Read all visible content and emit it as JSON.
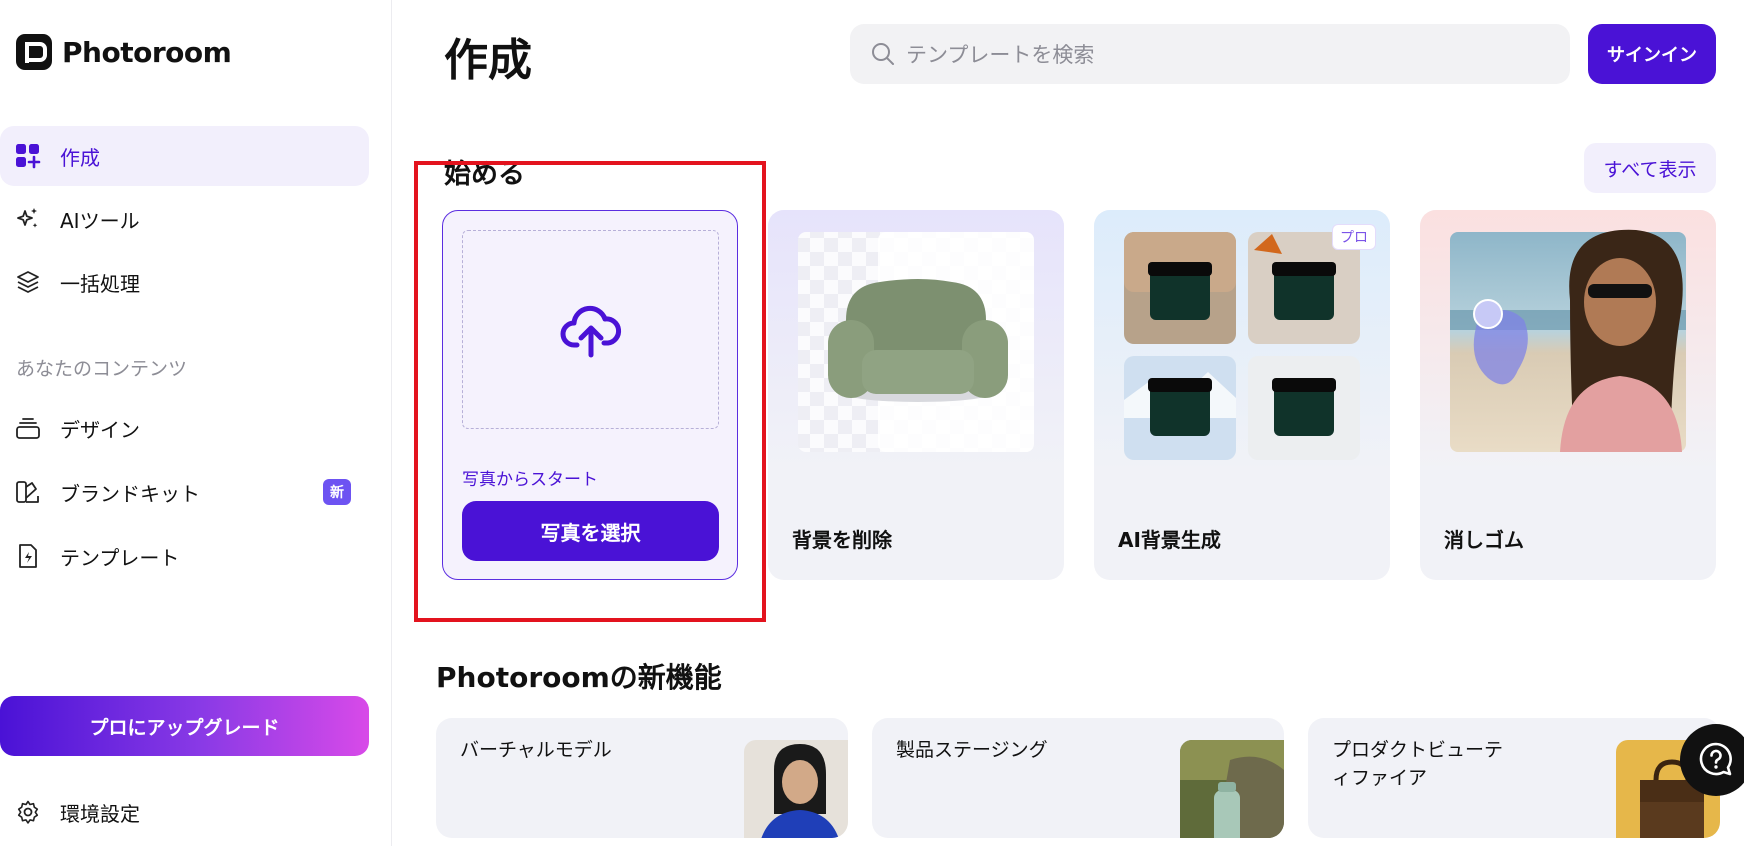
{
  "brand": {
    "name": "Photoroom"
  },
  "nav": {
    "items": [
      {
        "label": "作成",
        "icon": "grid-plus-icon",
        "active": true
      },
      {
        "label": "AIツール",
        "icon": "sparkle-icon",
        "active": false
      },
      {
        "label": "一括処理",
        "icon": "layers-icon",
        "active": false
      }
    ],
    "section_label": "あなたのコンテンツ",
    "content_items": [
      {
        "label": "デザイン",
        "icon": "stack-icon"
      },
      {
        "label": "ブランドキット",
        "icon": "brand-kit-icon",
        "badge": "新"
      },
      {
        "label": "テンプレート",
        "icon": "template-file-icon"
      }
    ],
    "upgrade_label": "プロにアップグレード",
    "settings_label": "環境設定"
  },
  "header": {
    "title": "作成",
    "search_placeholder": "テンプレートを検索",
    "signin_label": "サインイン"
  },
  "start": {
    "title": "始める",
    "show_all": "すべて表示",
    "upload": {
      "caption": "写真からスタート",
      "button": "写真を選択"
    },
    "tools": [
      {
        "label": "背景を削除"
      },
      {
        "label": "AI背景生成",
        "badge": "プロ"
      },
      {
        "label": "消しゴム"
      }
    ]
  },
  "new_features": {
    "title": "Photoroomの新機能",
    "items": [
      {
        "label": "バーチャルモデル"
      },
      {
        "label": "製品ステージング"
      },
      {
        "label": "プロダクトビューティファイア"
      }
    ]
  },
  "colors": {
    "accent": "#4a12d6",
    "highlight": "#e3131e"
  }
}
